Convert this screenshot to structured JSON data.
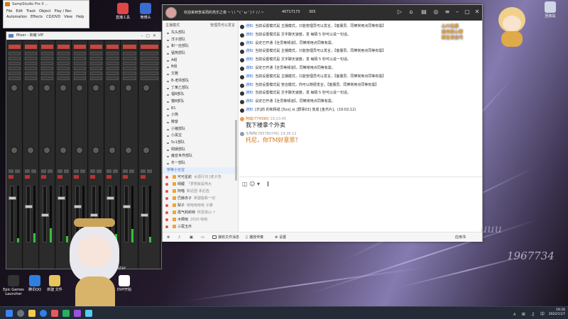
{
  "daw": {
    "title": "SampStudio Pro X ...",
    "menu": [
      "File",
      "Edit",
      "Track",
      "Object",
      "Play / Rec",
      "Automation",
      "Effects",
      "CD/DVD",
      "View",
      "Help"
    ]
  },
  "mixer": {
    "title": "Mixer - 和编 VIP",
    "master_label": "Master"
  },
  "desktop_icons": [
    {
      "label": "Epic Games Launcher",
      "color": "#333333"
    },
    {
      "label": "腾讯QQ",
      "color": "#2f7fe0"
    },
    {
      "label": "新建 文件",
      "color": "#e8c45a"
    },
    {
      "label": "VLC",
      "color": "#f08a1c"
    },
    {
      "label": "DVP开始",
      "color": "#ffffff"
    },
    {
      "label": "微博头",
      "color": "#3b6ccf"
    },
    {
      "label": "直播工具",
      "color": "#e04747"
    },
    {
      "label": "回收站",
      "color": "#cfd7e6"
    }
  ],
  "qq": {
    "title": "欢迎来到李采周的亮乐之夜 ~ \\ \\ ^( ' ω ' )ゞ / / ~",
    "group_id": "40717173",
    "member_count": "305",
    "sidebar": {
      "header_left": "主播模式",
      "header_right": "管理员可以发言",
      "groups": [
        "先头部队",
        "洋子部队",
        "和一丝部队",
        "猛熊部队",
        "A组",
        "B组",
        "文雅",
        "B-老师部队",
        "丁某乙部队",
        "福B部队",
        "猫B部队",
        "B1",
        "小熊",
        "散客",
        "小猪部队",
        "小黑宝",
        "5c1部队",
        "閏娱部队",
        "魔音世界部队",
        "冬一部队"
      ],
      "section": "饼等小仓宝",
      "members": [
        {
          "name": "可可星航",
          "status": "水源行刘 [老子洗",
          "dot": "#e94b4b"
        },
        {
          "name": "晴鲤",
          "status": "「梦想就是伟大",
          "dot": "#e94b4b"
        },
        {
          "name": "阿喵",
          "status": "和近团 本近选",
          "dot": "#e94b4b"
        },
        {
          "name": "巴赫赤子",
          "status": "希望能和一切",
          "dot": "#e94b4b"
        },
        {
          "name": "梨子",
          "status": "哈哈哈哈哈 子弹",
          "dot": "#e94b4b"
        },
        {
          "name": "霞气莉莉特",
          "status": "所爱高山 ↑",
          "dot": "#e94b4b"
        },
        {
          "name": "木卿雨",
          "status": "2020 哈哈",
          "dot": "#e94b4b"
        },
        {
          "name": "三尾玉乔",
          "status": "",
          "dot": "#e94b4b"
        }
      ]
    },
    "notices": [
      {
        "label": "通知:",
        "text": "当前设置模式是 主播模式，只能管理员可以发言，【客服员、同樂常用点同等有需】"
      },
      {
        "label": "通知:",
        "text": "当前设置模式是 文字聊天速度，发 每隔 5 秒可以说一句话。"
      },
      {
        "label": "通知:",
        "text": "设定已开通【全员等频道】，同樂常用点同等有需。"
      },
      {
        "label": "通知:",
        "text": "当前设置模式是 主播模式，只能管理员可以发言，【客服员、同樂常用点同等有需】"
      },
      {
        "label": "通知:",
        "text": "当前设置模式是 文字聊天速度，发 每隔 5 秒可以说一句话。"
      },
      {
        "label": "通知:",
        "text": "设定已开通【全员等频道】，同樂常用点同等有需。"
      },
      {
        "label": "通知:",
        "text": "当前设置模式是 主播模式，只能管理员可以发言，【客服员、同樂常用点同等有需】"
      },
      {
        "label": "通知:",
        "text": "当前设置模式是 管治模式，你可以随便发言。【客服员、同樂常用点同等有需】"
      },
      {
        "label": "通知:",
        "text": "当前设置模式是 文字聊天速度，发 每隔 5 秒可以说一句话。"
      },
      {
        "label": "通知:",
        "text": "设定已开通【全员等频道】，同樂常用点同等有需。"
      },
      {
        "label": "通知:",
        "text": "[乐]的 的和挥纸 [5xx] 从 [群事03] 变成 [金杰片]。(19:02:12)"
      }
    ],
    "chat": [
      {
        "name": "阿瑜(774390)",
        "time": "19:23:45",
        "text": "我下楼拿个外卖",
        "style": "normal"
      },
      {
        "name": "东陶陶(785780745)",
        "time": "19:26:12",
        "text": "托尼，你TM好意思？",
        "style": "orange"
      }
    ],
    "input": {
      "tools": "◫ ☺ ▾"
    },
    "send_hint": "↵  ☺ ▾",
    "bottom": {
      "record": "接收文件消息",
      "music": "播放伴奏",
      "settings": "设置",
      "apply": "应用书"
    }
  },
  "overlay": {
    "logo_lines": [
      "心川北辰",
      "四月的心事",
      "新生活吉巧"
    ],
    "deco_text": "uuu",
    "stream_id": "1967734"
  },
  "taskbar": {
    "tray": "∧  ⊞  ♫  中",
    "time": "19:26",
    "date": "2022/11/7"
  }
}
